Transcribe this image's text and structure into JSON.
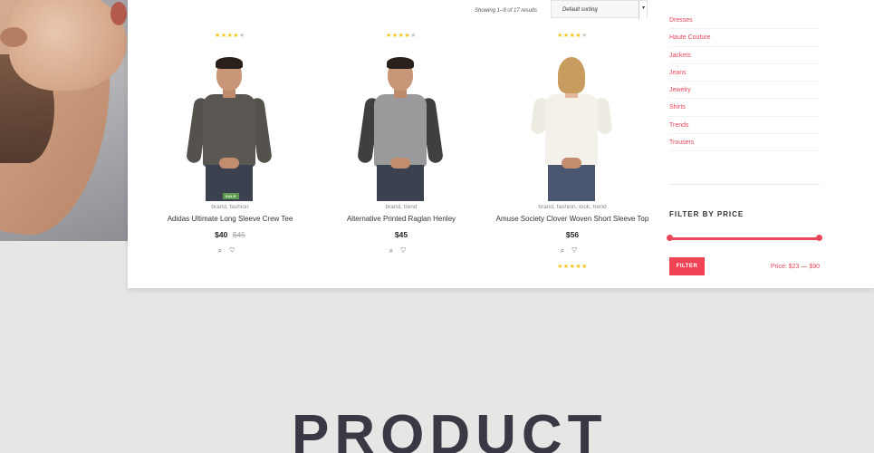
{
  "results_text": "Showing 1–9 of 17 results",
  "sort": {
    "selected": "Default sorting"
  },
  "products": [
    {
      "rating": 4,
      "tags": "brand, fashion",
      "title": "Adidas Ultimate Long Sleeve Crew Tee",
      "price": "$40",
      "old_price": "$45",
      "badge": "SALE",
      "shirt_color": "#5a5651",
      "sleeve_color": "#55514c"
    },
    {
      "rating": 4,
      "tags": "brand, trend",
      "title": "Alternative Printed Raglan Henley",
      "price": "$45",
      "shirt_color": "#9a9a9c",
      "sleeve_color": "#3f3f42"
    },
    {
      "rating": 4,
      "tags": "brand, fashion, look, trend",
      "title": "Amuse Society Clover Woven Short Sleeve Top",
      "price": "$56",
      "bottom_rating": 5,
      "shirt_color": "#f4f1ea",
      "sleeve_color": "#eeebe3"
    }
  ],
  "sidebar": {
    "categories": [
      "Dresses",
      "Haute Couture",
      "Jackets",
      "Jeans",
      "Jewelry",
      "Shirts",
      "Trends",
      "Trousers"
    ],
    "filter_title": "FILTER BY PRICE",
    "filter_button": "FILTER",
    "price_range": "Price: $23 — $90"
  },
  "heading": "PRODUCT",
  "colors": {
    "accent": "#e8475b",
    "star": "#f5c518",
    "sale_badge": "#5d9a4f",
    "heading": "#3a3845"
  }
}
